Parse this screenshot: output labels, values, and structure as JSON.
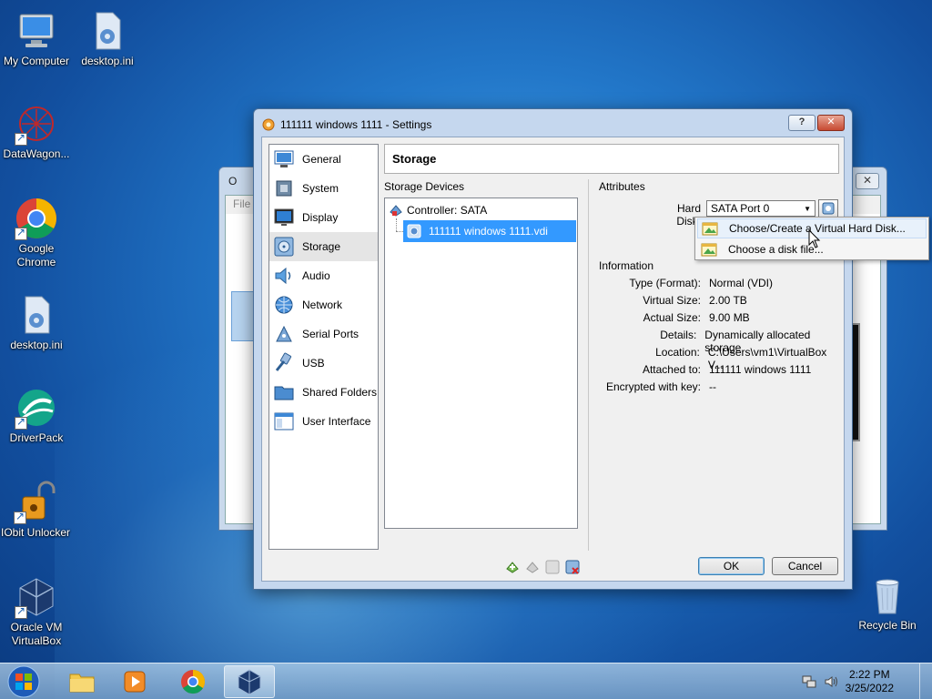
{
  "desktop": {
    "icons": [
      {
        "label": "My Computer",
        "icon": "computer-icon"
      },
      {
        "label": "desktop.ini",
        "icon": "ini-file-icon"
      },
      {
        "label": "DataWagon...",
        "icon": "datawagon-icon"
      },
      {
        "label": "Google Chrome",
        "icon": "chrome-icon"
      },
      {
        "label": "desktop.ini",
        "icon": "ini-file-icon"
      },
      {
        "label": "DriverPack",
        "icon": "driverpack-icon"
      },
      {
        "label": "IObit Unlocker",
        "icon": "iobit-unlocker-icon"
      },
      {
        "label": "Oracle VM VirtualBox",
        "icon": "virtualbox-icon"
      },
      {
        "label": "Recycle Bin",
        "icon": "recycle-bin-icon"
      }
    ]
  },
  "back_window": {
    "title": "O",
    "menu": "File"
  },
  "dialog": {
    "title": "111111 windows  1111 - Settings",
    "help_label": "?",
    "close_label": "✕",
    "sidebar": [
      {
        "label": "General",
        "icon": "general-icon"
      },
      {
        "label": "System",
        "icon": "system-icon"
      },
      {
        "label": "Display",
        "icon": "display-icon"
      },
      {
        "label": "Storage",
        "icon": "storage-icon",
        "active": true
      },
      {
        "label": "Audio",
        "icon": "audio-icon"
      },
      {
        "label": "Network",
        "icon": "network-icon"
      },
      {
        "label": "Serial Ports",
        "icon": "serial-ports-icon"
      },
      {
        "label": "USB",
        "icon": "usb-icon"
      },
      {
        "label": "Shared Folders",
        "icon": "shared-folders-icon"
      },
      {
        "label": "User Interface",
        "icon": "user-interface-icon"
      }
    ],
    "page_title": "Storage",
    "storage_devices_label": "Storage Devices",
    "controller_label": "Controller: SATA",
    "disk_label": "111111 windows  1111.vdi",
    "attributes_label": "Attributes",
    "hard_disk_label": "Hard Disk:",
    "hard_disk_value": "SATA Port 0",
    "information_label": "Information",
    "info": [
      {
        "label": "Type (Format):",
        "value": "Normal (VDI)"
      },
      {
        "label": "Virtual Size:",
        "value": "2.00 TB"
      },
      {
        "label": "Actual Size:",
        "value": "9.00 MB"
      },
      {
        "label": "Details:",
        "value": "Dynamically allocated storage"
      },
      {
        "label": "Location:",
        "value": "C:\\Users\\vm1\\VirtualBox V..."
      },
      {
        "label": "Attached to:",
        "value": "111111 windows 1111"
      },
      {
        "label": "Encrypted with key:",
        "value": "--"
      }
    ],
    "ok_label": "OK",
    "cancel_label": "Cancel"
  },
  "popup": {
    "items": [
      {
        "label": "Choose/Create a Virtual Hard Disk...",
        "hover": true
      },
      {
        "label": "Choose a disk file..."
      }
    ]
  },
  "taskbar": {
    "clock_time": "2:22 PM",
    "clock_date": "3/25/2022"
  },
  "colors": {
    "selection": "#3399ff",
    "desktop_blue": "#1f6fc4"
  }
}
